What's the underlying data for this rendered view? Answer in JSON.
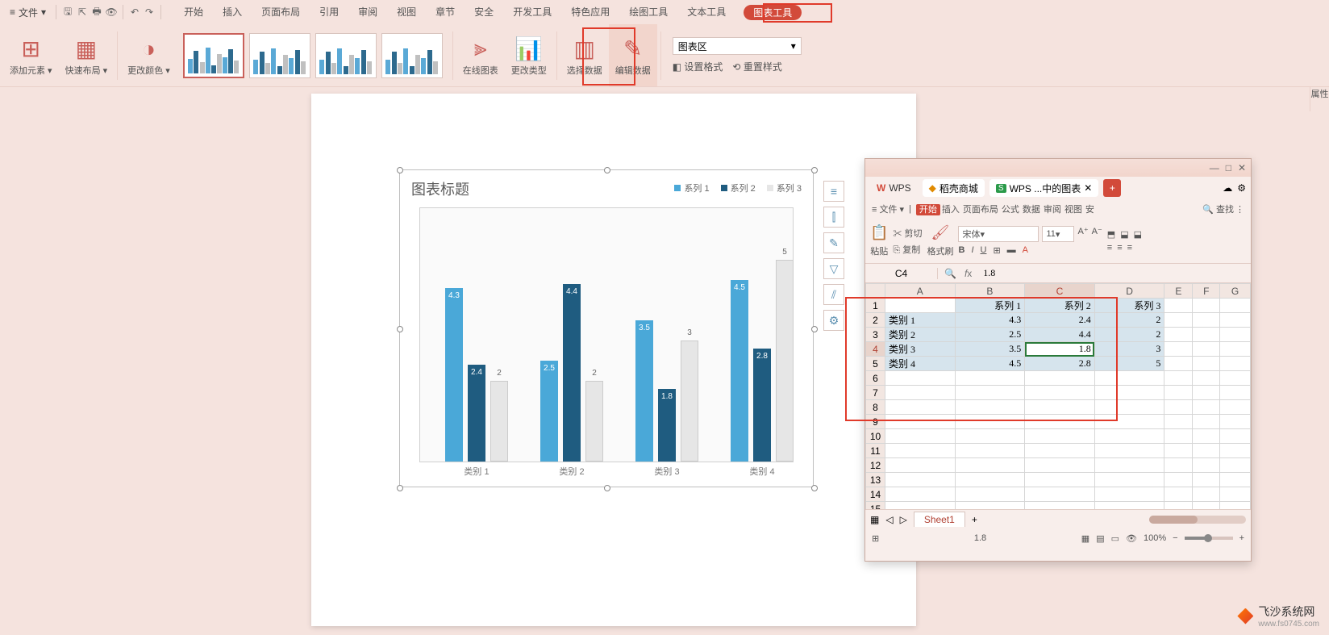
{
  "top": {
    "file": "文件",
    "icons": [
      "save",
      "export",
      "print",
      "preview",
      "undo",
      "redo"
    ],
    "tabs": [
      "开始",
      "插入",
      "页面布局",
      "引用",
      "审阅",
      "视图",
      "章节",
      "安全",
      "开发工具",
      "特色应用",
      "绘图工具",
      "文本工具",
      "图表工具"
    ],
    "active_tab": "图表工具"
  },
  "ribbon": {
    "add_element": "添加元素",
    "quick_layout": "快速布局",
    "change_colors": "更改颜色",
    "online_chart": "在线图表",
    "change_type": "更改类型",
    "select_data": "选择数据",
    "edit_data": "编辑数据",
    "chart_area_label": "图表区",
    "set_format": "设置格式",
    "reset_style": "重置样式"
  },
  "right_strip": "属性",
  "chart_data": {
    "type": "bar",
    "title": "图表标题",
    "categories": [
      "类别 1",
      "类别 2",
      "类别 3",
      "类别 4"
    ],
    "series": [
      {
        "name": "系列 1",
        "values": [
          4.3,
          2.5,
          3.5,
          4.5
        ],
        "color": "#4aa8d8"
      },
      {
        "name": "系列 2",
        "values": [
          2.4,
          4.4,
          1.8,
          2.8
        ],
        "color": "#1f5c80"
      },
      {
        "name": "系列 3",
        "values": [
          2,
          2,
          3,
          5
        ],
        "color": "#e6e6e6"
      }
    ],
    "ylim": [
      0,
      6
    ]
  },
  "side_icons": [
    "layout",
    "axes",
    "brush",
    "filter",
    "style",
    "more"
  ],
  "excel": {
    "app_tabs": {
      "wps": "WPS",
      "docer": "稻壳商城",
      "active": "WPS ...中的图表"
    },
    "file": "文件",
    "menus": [
      "开始",
      "插入",
      "页面布局",
      "公式",
      "数据",
      "审阅",
      "视图",
      "安"
    ],
    "search": "查找",
    "paste": "粘贴",
    "cut": "剪切",
    "copy": "复制",
    "format_painter": "格式刷",
    "font_name": "宋体",
    "font_size": "11",
    "namebox": "C4",
    "formula": "1.8",
    "cols": [
      "A",
      "B",
      "C",
      "D",
      "E",
      "F",
      "G"
    ],
    "rows": 15,
    "headers": [
      "",
      "系列 1",
      "系列 2",
      "系列 3"
    ],
    "data": [
      [
        "类别 1",
        4.3,
        2.4,
        2
      ],
      [
        "类别 2",
        2.5,
        4.4,
        2
      ],
      [
        "类别 3",
        3.5,
        1.8,
        3
      ],
      [
        "类别 4",
        4.5,
        2.8,
        5
      ]
    ],
    "active_cell": {
      "row": 4,
      "col": "C"
    },
    "sheet": "Sheet1",
    "status_val": "1.8",
    "zoom": "100%"
  },
  "watermark": {
    "name": "飞沙系统网",
    "url": "www.fs0745.com"
  }
}
